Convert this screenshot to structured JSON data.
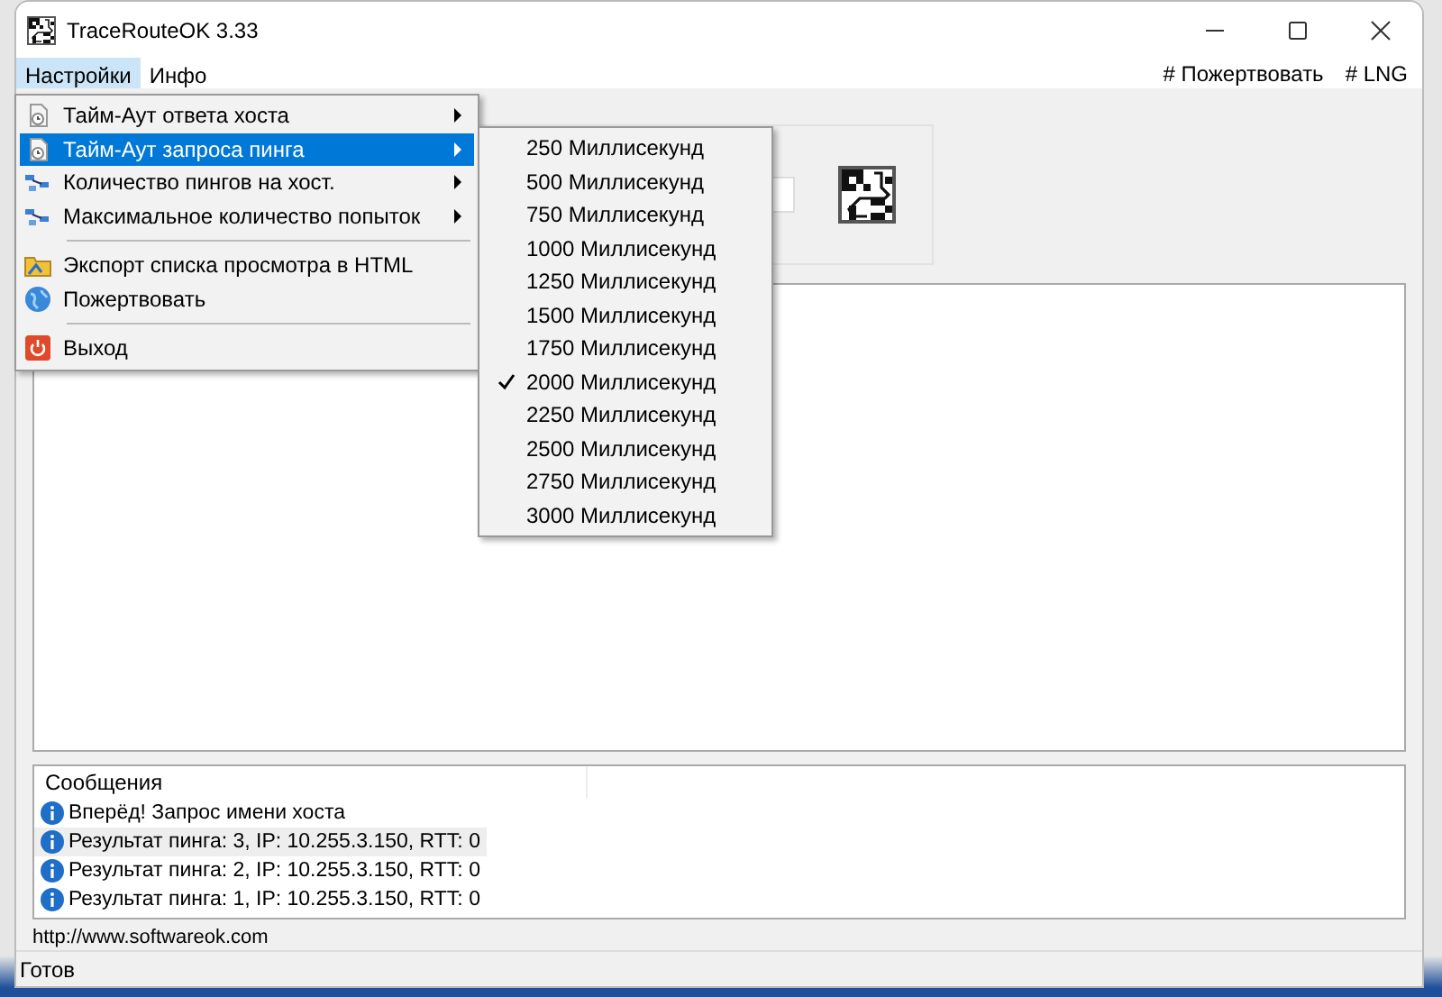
{
  "window": {
    "title": "TraceRouteOK 3.33"
  },
  "menubar": {
    "items": [
      {
        "label": "Настройки",
        "selected": true
      },
      {
        "label": "Инфо",
        "selected": false
      }
    ],
    "links": [
      "# Пожертвовать",
      "# LNG"
    ]
  },
  "menu": {
    "items": [
      {
        "kind": "submenu",
        "label": "Тайм-Аут ответа хоста",
        "selected": false
      },
      {
        "kind": "submenu",
        "label": "Тайм-Аут запроса пинга",
        "selected": true
      },
      {
        "kind": "submenu",
        "label": "Количество пингов на хост.",
        "selected": false
      },
      {
        "kind": "submenu",
        "label": "Максимальное количество попыток",
        "selected": false
      },
      {
        "kind": "separator"
      },
      {
        "kind": "command",
        "label": "Экспорт списка просмотра в HTML",
        "selected": false
      },
      {
        "kind": "command",
        "label": "Пожертвовать",
        "selected": false
      },
      {
        "kind": "separator"
      },
      {
        "kind": "command",
        "label": "Выход",
        "selected": false
      }
    ]
  },
  "submenu": {
    "items": [
      {
        "label": "250 Миллисекунд",
        "checked": false
      },
      {
        "label": "500 Миллисекунд",
        "checked": false
      },
      {
        "label": "750 Миллисекунд",
        "checked": false
      },
      {
        "label": "1000 Миллисекунд",
        "checked": false
      },
      {
        "label": "1250 Миллисекунд",
        "checked": false
      },
      {
        "label": "1500 Миллисекунд",
        "checked": false
      },
      {
        "label": "1750 Миллисекунд",
        "checked": false
      },
      {
        "label": "2000 Миллисекунд",
        "checked": true
      },
      {
        "label": "2250 Миллисекунд",
        "checked": false
      },
      {
        "label": "2500 Миллисекунд",
        "checked": false
      },
      {
        "label": "2750 Миллисекунд",
        "checked": false
      },
      {
        "label": "3000 Миллисекунд",
        "checked": false
      }
    ]
  },
  "messages": {
    "column": "Сообщения",
    "rows": [
      {
        "text": "Вперёд! Запрос имени хоста",
        "selected": false
      },
      {
        "text": "Результат пинга: 3, IP: 10.255.3.150, RTT: 0",
        "selected": true
      },
      {
        "text": "Результат пинга: 2, IP: 10.255.3.150, RTT: 0",
        "selected": false
      },
      {
        "text": "Результат пинга: 1, IP: 10.255.3.150, RTT: 0",
        "selected": false
      }
    ]
  },
  "url": "http://www.softwareok.com",
  "status_bar": "Готов"
}
